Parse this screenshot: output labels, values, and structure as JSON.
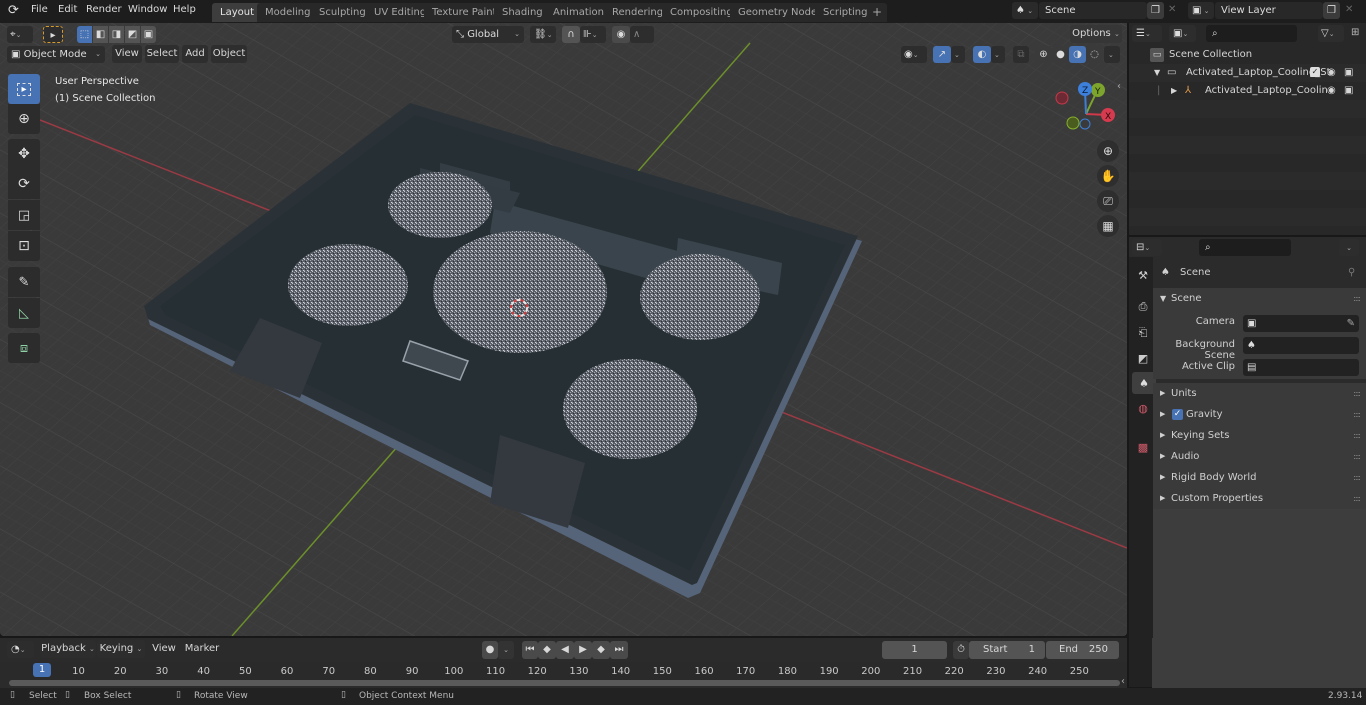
{
  "app": {
    "version": "2.93.14"
  },
  "menu": [
    "File",
    "Edit",
    "Render",
    "Window",
    "Help"
  ],
  "workspaces": [
    "Layout",
    "Modeling",
    "Sculpting",
    "UV Editing",
    "Texture Paint",
    "Shading",
    "Animation",
    "Rendering",
    "Compositing",
    "Geometry Nodes",
    "Scripting"
  ],
  "active_workspace": "Layout",
  "scene_selector": {
    "value": "Scene",
    "icon": "scene-icon"
  },
  "view_layer_selector": {
    "value": "View Layer",
    "icon": "render-layer-icon"
  },
  "viewport": {
    "mode": "Object Mode",
    "header_menus": [
      "View",
      "Select",
      "Add",
      "Object"
    ],
    "transform_orientation": "Global",
    "options_label": "Options",
    "overlay_text": {
      "line1": "User Perspective",
      "line2": "(1) Scene Collection"
    },
    "toolbar": [
      {
        "name": "select-box-tool",
        "icon": "select-box-icon",
        "active": true
      },
      {
        "name": "cursor-tool",
        "icon": "cursor-icon",
        "active": false
      },
      {
        "name": "move-tool",
        "icon": "move-icon",
        "active": false
      },
      {
        "name": "rotate-tool",
        "icon": "rotate-icon",
        "active": false
      },
      {
        "name": "scale-tool",
        "icon": "scale-icon",
        "active": false
      },
      {
        "name": "transform-tool",
        "icon": "transform-icon",
        "active": false
      },
      {
        "name": "annotate-tool",
        "icon": "annotate-icon",
        "active": false
      },
      {
        "name": "measure-tool",
        "icon": "measure-icon",
        "active": false
      },
      {
        "name": "add-cube-tool",
        "icon": "add-cube-icon",
        "active": false
      }
    ],
    "gizmo_axes": [
      "X",
      "Y",
      "Z"
    ],
    "nav_buttons": [
      "zoom-icon",
      "pan-hand-icon",
      "camera-icon",
      "perspective-grid-icon"
    ]
  },
  "outliner": {
    "search_placeholder": "",
    "root": "Scene Collection",
    "items": [
      {
        "label": "Activated_Laptop_Cooling_St",
        "type": "collection",
        "expanded": true,
        "checked": true
      },
      {
        "label": "Activated_Laptop_Coolin",
        "type": "object",
        "expanded": false
      }
    ]
  },
  "properties": {
    "search_placeholder": "",
    "context_title": "Scene",
    "panel_title": "Scene",
    "fields": [
      {
        "label": "Camera",
        "value": "",
        "icon": "camera-data-icon"
      },
      {
        "label": "Background Scene",
        "value": "",
        "icon": "scene-icon"
      },
      {
        "label": "Active Clip",
        "value": "",
        "icon": "clip-icon"
      }
    ],
    "collapsed_panels": [
      {
        "label": "Units"
      },
      {
        "label": "Gravity",
        "checkbox": true
      },
      {
        "label": "Keying Sets"
      },
      {
        "label": "Audio"
      },
      {
        "label": "Rigid Body World"
      },
      {
        "label": "Custom Properties"
      }
    ],
    "tabs": [
      "tool-icon",
      "render-icon",
      "output-icon",
      "view-layer-icon",
      "scene-icon",
      "world-icon",
      "texture-icon"
    ],
    "active_tab": "scene-icon"
  },
  "timeline": {
    "menus": [
      "Playback",
      "Keying",
      "View",
      "Marker"
    ],
    "current_frame": "1",
    "start_label": "Start",
    "start": "1",
    "end_label": "End",
    "end": "250",
    "ticks": [
      "10",
      "20",
      "30",
      "40",
      "50",
      "60",
      "70",
      "80",
      "90",
      "100",
      "110",
      "120",
      "130",
      "140",
      "150",
      "160",
      "170",
      "180",
      "190",
      "200",
      "210",
      "220",
      "230",
      "240",
      "250"
    ],
    "playhead": "1"
  },
  "statusbar": {
    "items": [
      {
        "icon": "mouse-left-icon",
        "label": "Select"
      },
      {
        "icon": "mouse-drag-icon",
        "label": "Box Select"
      },
      {
        "icon": "mouse-middle-icon",
        "label": "Rotate View"
      },
      {
        "icon": "mouse-right-icon",
        "label": "Object Context Menu"
      }
    ]
  }
}
